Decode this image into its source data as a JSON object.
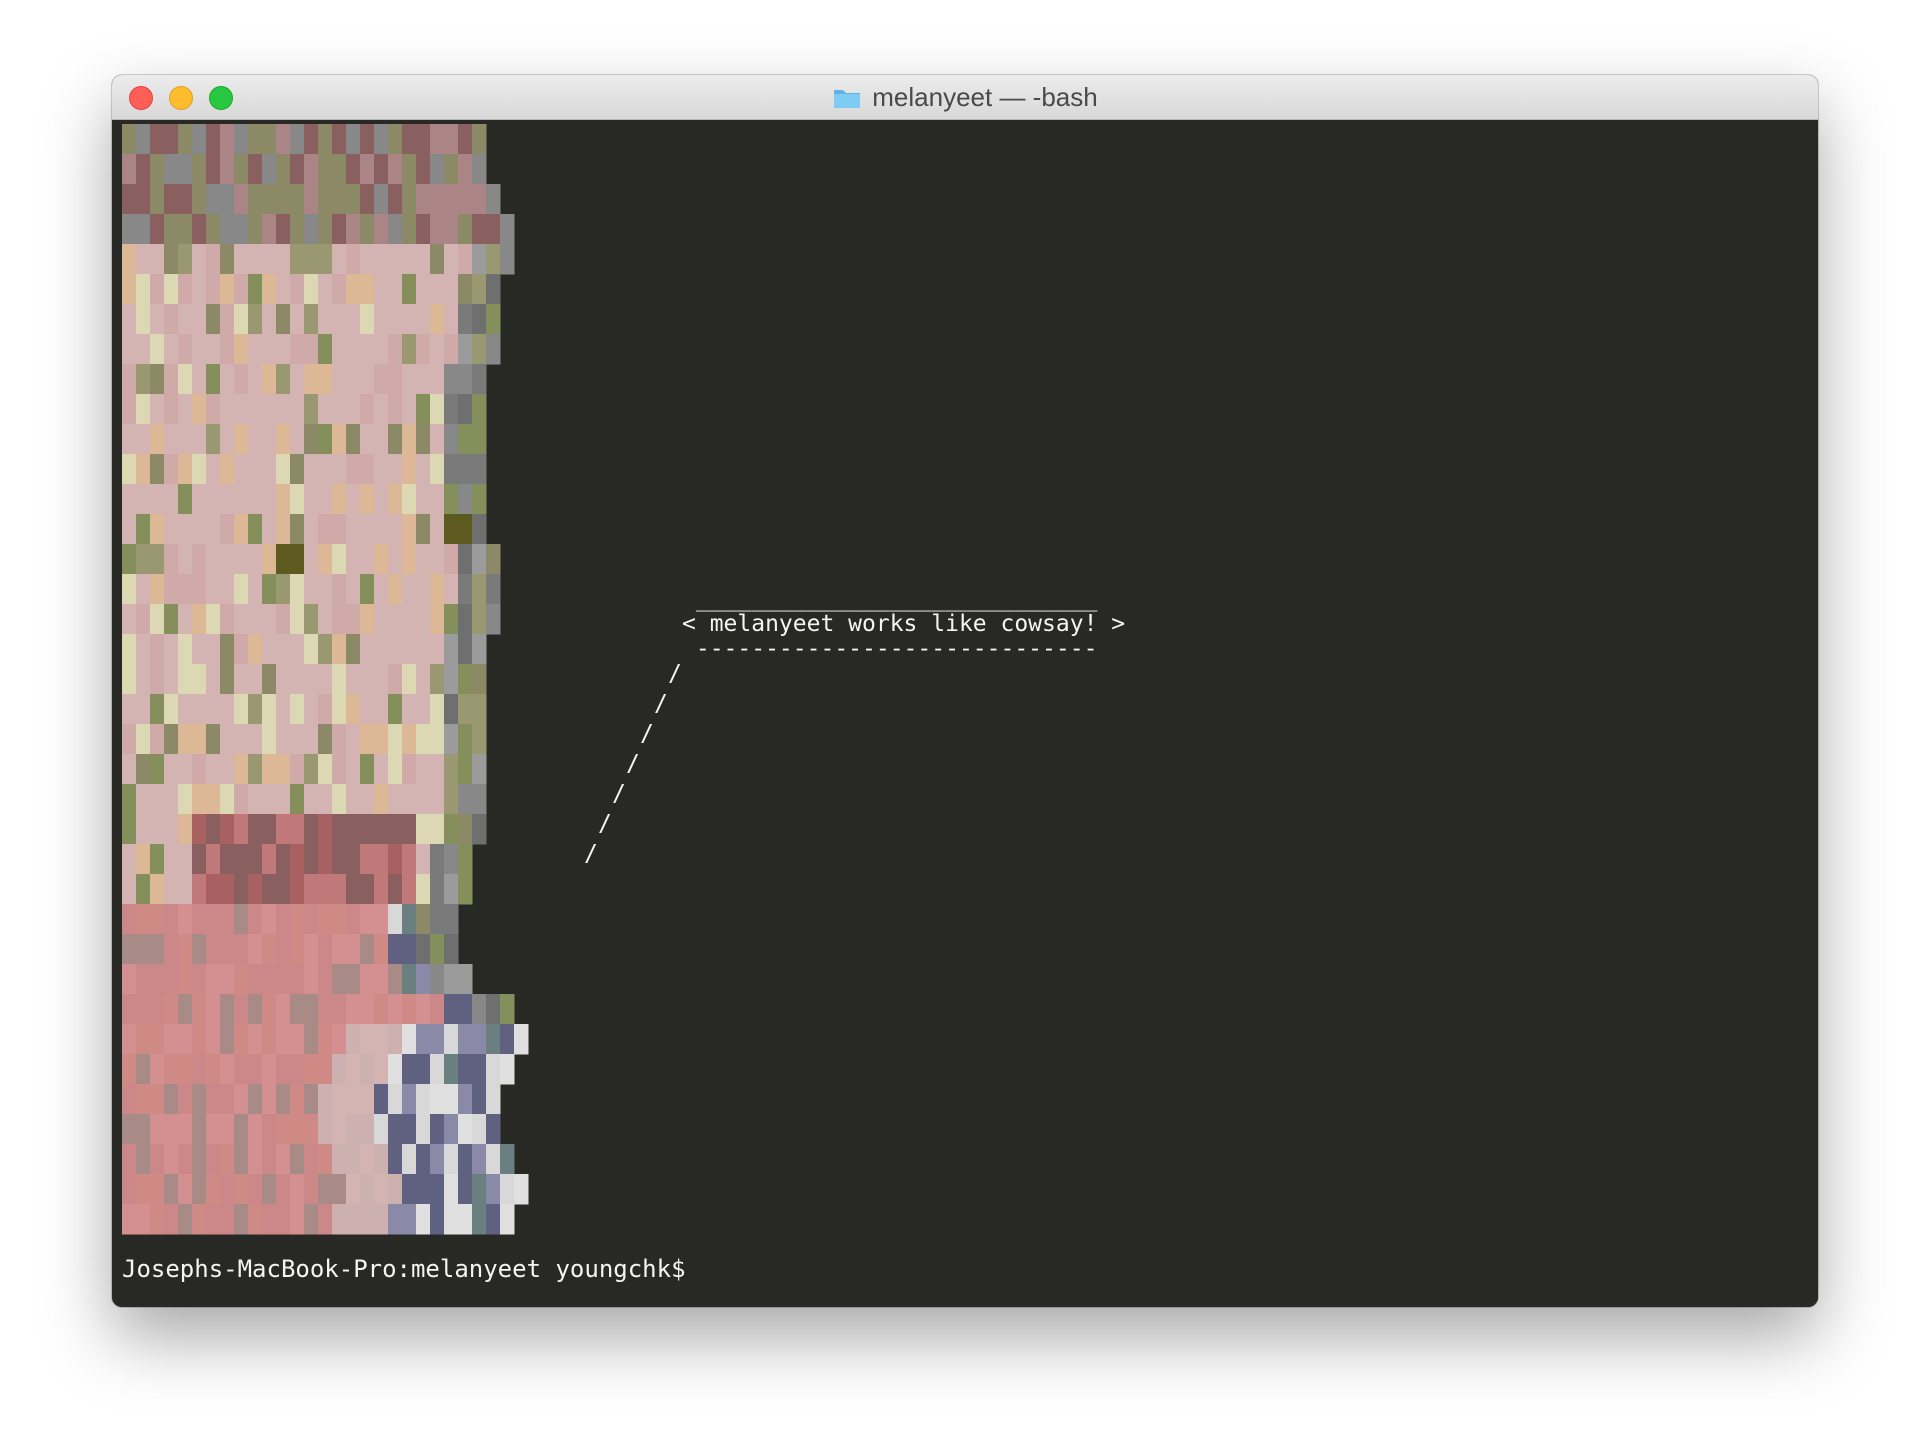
{
  "window": {
    "title": "melanyeet — -bash"
  },
  "icons": {
    "folder": "folder-icon",
    "close": "close-icon",
    "minimize": "minimize-icon",
    "maximize": "maximize-icon"
  },
  "colors": {
    "terminal_bg": "#282825",
    "text": "#f4f4f4",
    "close": "#ff5f57",
    "minimize": "#febc2e",
    "maximize": "#28c840",
    "folder": "#6ec1f0"
  },
  "speech_bubble": {
    "top": " _____________________________",
    "message": "< melanyeet works like cowsay! >",
    "bottom": " -----------------------------"
  },
  "tail_lines": [
    "/",
    "/",
    "/",
    "/",
    "/",
    "/",
    "/"
  ],
  "prompt": "Josephs-MacBook-Pro:melanyeet youngchk$"
}
